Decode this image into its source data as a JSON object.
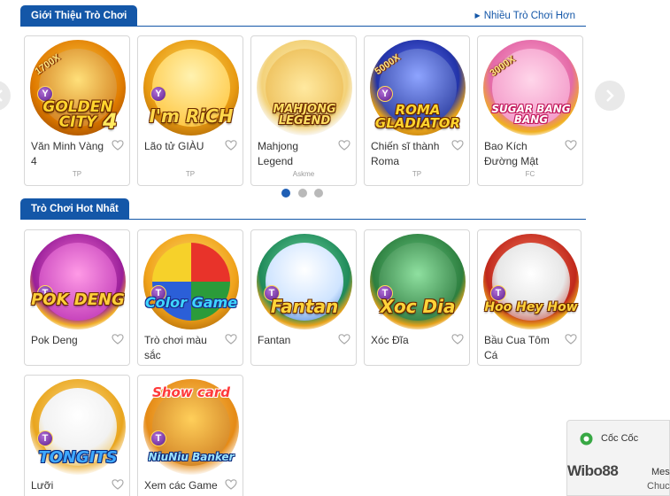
{
  "section1": {
    "title": "Giới Thiệu Trò Chơi",
    "more_link": "Nhiều Trò Chơi Hơn"
  },
  "section2": {
    "title": "Trò Chơi Hot Nhất"
  },
  "intro_games": [
    {
      "title": "Văn Minh Vàng 4",
      "provider": "TP",
      "logo": "GOLDEN CITY",
      "logo_num": "4",
      "multi": "1700X",
      "badge": "Y"
    },
    {
      "title": "Lão tử GIÀU",
      "provider": "TP",
      "logo": "I'm RiCH",
      "badge": "Y"
    },
    {
      "title": "Mahjong Legend",
      "provider": "Askme",
      "logo": "MAHJONG LEGEND"
    },
    {
      "title": "Chiến sĩ thành Roma",
      "provider": "TP",
      "logo": "ROMA GLADIATOR",
      "multi": "5000X",
      "badge": "Y"
    },
    {
      "title": "Bao Kích Đường Mật",
      "provider": "FC",
      "logo": "SUGAR BANG BANG",
      "multi": "3000X"
    }
  ],
  "hot_games": [
    {
      "title": "Pok Deng",
      "logo": "POK DENG",
      "badge": "T"
    },
    {
      "title": "Trò chơi màu sắc",
      "logo": "Color Game",
      "badge": "T"
    },
    {
      "title": "Fantan",
      "logo": "Fantan",
      "badge": "T"
    },
    {
      "title": "Xóc Đĩa",
      "logo": "Xoc Dia",
      "badge": "T"
    },
    {
      "title": "Bầu Cua Tôm Cá",
      "logo": "Hoo Hey How",
      "badge": "T"
    },
    {
      "title": "Lưỡi",
      "logo": "TONGITS",
      "badge": "T"
    },
    {
      "title": "Xem các Game",
      "logo": "NiuNiu Banker",
      "extra": "Show card",
      "badge": "T"
    }
  ],
  "carousel": {
    "pages": 3,
    "active": 0
  },
  "overlay": {
    "browser": "Cốc Cốc",
    "watermark": "Wibo88",
    "mes": "Mes",
    "chuc": "Chuc"
  },
  "colors": {
    "primary": "#1457a8",
    "dot_active": "#1f5fb5",
    "dot_inactive": "#b9b9b9"
  },
  "icons": {
    "favorite": "heart-icon",
    "prev": "chevron-left-icon",
    "next": "chevron-right-icon",
    "more": "caret-right-icon"
  }
}
